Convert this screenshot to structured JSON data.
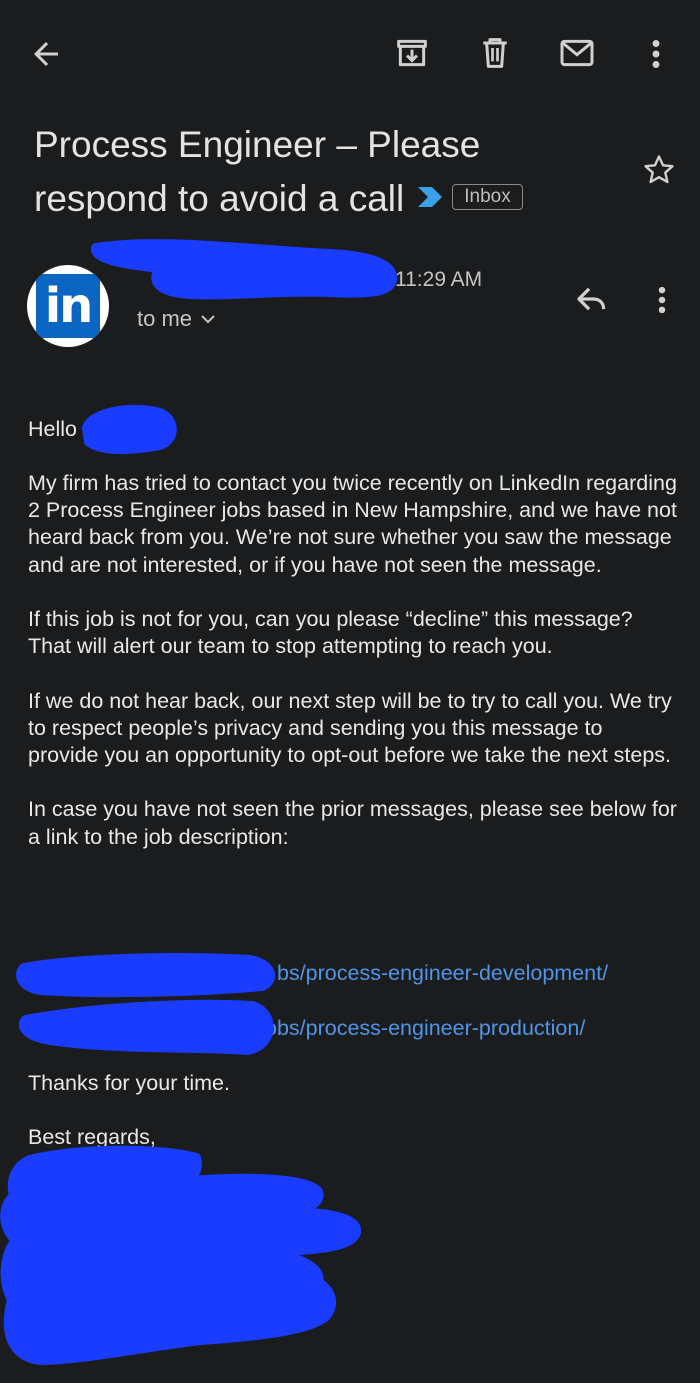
{
  "toolbar": {
    "icons": [
      "back-arrow-icon",
      "archive-icon",
      "delete-icon",
      "mark-unread-icon",
      "more-vert-icon"
    ]
  },
  "email": {
    "subject": "Process Engineer – Please respond to avoid a call",
    "label": "Inbox",
    "sender_name": "",
    "time": "11:29 AM",
    "recipient": "to me",
    "avatar_text": "in",
    "greeting": "Hello",
    "paragraphs": [
      "My firm has tried to contact you twice recently on LinkedIn regarding 2 Process Engineer jobs based in New Hampshire, and we have not heard back from you. We’re not sure whether you saw the message and are not interested, or if you have not seen the message.",
      "If this job is not for you, can you please “decline” this message? That will alert our team to stop attempting to reach you.",
      "If we do not hear back, our next step will be to try to call you. We try to respect people’s privacy and sending you this message to provide you an opportunity to opt-out before we take the next steps.",
      "In case you have not seen the prior messages, please see below for a link to the job description:"
    ],
    "links": [
      "bs/process-engineer-development/",
      "obs/process-engineer-production/"
    ],
    "thanks": "Thanks for your time.",
    "signoff": "Best regards,"
  },
  "colors": {
    "background": "#1a1c1e",
    "link": "#4f95e8",
    "redaction": "#1a3cff",
    "linkedin": "#0a66c2",
    "importance_marker": "#3aa0e8"
  }
}
